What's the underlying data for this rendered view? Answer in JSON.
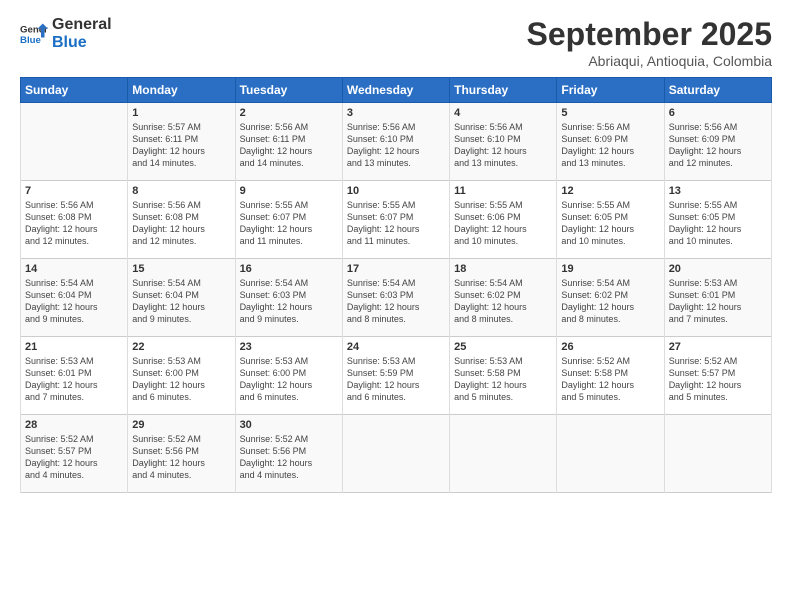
{
  "logo": {
    "line1": "General",
    "line2": "Blue"
  },
  "title": "September 2025",
  "subtitle": "Abriaqui, Antioquia, Colombia",
  "weekdays": [
    "Sunday",
    "Monday",
    "Tuesday",
    "Wednesday",
    "Thursday",
    "Friday",
    "Saturday"
  ],
  "weeks": [
    [
      {
        "day": "",
        "text": ""
      },
      {
        "day": "1",
        "text": "Sunrise: 5:57 AM\nSunset: 6:11 PM\nDaylight: 12 hours\nand 14 minutes."
      },
      {
        "day": "2",
        "text": "Sunrise: 5:56 AM\nSunset: 6:11 PM\nDaylight: 12 hours\nand 14 minutes."
      },
      {
        "day": "3",
        "text": "Sunrise: 5:56 AM\nSunset: 6:10 PM\nDaylight: 12 hours\nand 13 minutes."
      },
      {
        "day": "4",
        "text": "Sunrise: 5:56 AM\nSunset: 6:10 PM\nDaylight: 12 hours\nand 13 minutes."
      },
      {
        "day": "5",
        "text": "Sunrise: 5:56 AM\nSunset: 6:09 PM\nDaylight: 12 hours\nand 13 minutes."
      },
      {
        "day": "6",
        "text": "Sunrise: 5:56 AM\nSunset: 6:09 PM\nDaylight: 12 hours\nand 12 minutes."
      }
    ],
    [
      {
        "day": "7",
        "text": "Sunrise: 5:56 AM\nSunset: 6:08 PM\nDaylight: 12 hours\nand 12 minutes."
      },
      {
        "day": "8",
        "text": "Sunrise: 5:56 AM\nSunset: 6:08 PM\nDaylight: 12 hours\nand 12 minutes."
      },
      {
        "day": "9",
        "text": "Sunrise: 5:55 AM\nSunset: 6:07 PM\nDaylight: 12 hours\nand 11 minutes."
      },
      {
        "day": "10",
        "text": "Sunrise: 5:55 AM\nSunset: 6:07 PM\nDaylight: 12 hours\nand 11 minutes."
      },
      {
        "day": "11",
        "text": "Sunrise: 5:55 AM\nSunset: 6:06 PM\nDaylight: 12 hours\nand 10 minutes."
      },
      {
        "day": "12",
        "text": "Sunrise: 5:55 AM\nSunset: 6:05 PM\nDaylight: 12 hours\nand 10 minutes."
      },
      {
        "day": "13",
        "text": "Sunrise: 5:55 AM\nSunset: 6:05 PM\nDaylight: 12 hours\nand 10 minutes."
      }
    ],
    [
      {
        "day": "14",
        "text": "Sunrise: 5:54 AM\nSunset: 6:04 PM\nDaylight: 12 hours\nand 9 minutes."
      },
      {
        "day": "15",
        "text": "Sunrise: 5:54 AM\nSunset: 6:04 PM\nDaylight: 12 hours\nand 9 minutes."
      },
      {
        "day": "16",
        "text": "Sunrise: 5:54 AM\nSunset: 6:03 PM\nDaylight: 12 hours\nand 9 minutes."
      },
      {
        "day": "17",
        "text": "Sunrise: 5:54 AM\nSunset: 6:03 PM\nDaylight: 12 hours\nand 8 minutes."
      },
      {
        "day": "18",
        "text": "Sunrise: 5:54 AM\nSunset: 6:02 PM\nDaylight: 12 hours\nand 8 minutes."
      },
      {
        "day": "19",
        "text": "Sunrise: 5:54 AM\nSunset: 6:02 PM\nDaylight: 12 hours\nand 8 minutes."
      },
      {
        "day": "20",
        "text": "Sunrise: 5:53 AM\nSunset: 6:01 PM\nDaylight: 12 hours\nand 7 minutes."
      }
    ],
    [
      {
        "day": "21",
        "text": "Sunrise: 5:53 AM\nSunset: 6:01 PM\nDaylight: 12 hours\nand 7 minutes."
      },
      {
        "day": "22",
        "text": "Sunrise: 5:53 AM\nSunset: 6:00 PM\nDaylight: 12 hours\nand 6 minutes."
      },
      {
        "day": "23",
        "text": "Sunrise: 5:53 AM\nSunset: 6:00 PM\nDaylight: 12 hours\nand 6 minutes."
      },
      {
        "day": "24",
        "text": "Sunrise: 5:53 AM\nSunset: 5:59 PM\nDaylight: 12 hours\nand 6 minutes."
      },
      {
        "day": "25",
        "text": "Sunrise: 5:53 AM\nSunset: 5:58 PM\nDaylight: 12 hours\nand 5 minutes."
      },
      {
        "day": "26",
        "text": "Sunrise: 5:52 AM\nSunset: 5:58 PM\nDaylight: 12 hours\nand 5 minutes."
      },
      {
        "day": "27",
        "text": "Sunrise: 5:52 AM\nSunset: 5:57 PM\nDaylight: 12 hours\nand 5 minutes."
      }
    ],
    [
      {
        "day": "28",
        "text": "Sunrise: 5:52 AM\nSunset: 5:57 PM\nDaylight: 12 hours\nand 4 minutes."
      },
      {
        "day": "29",
        "text": "Sunrise: 5:52 AM\nSunset: 5:56 PM\nDaylight: 12 hours\nand 4 minutes."
      },
      {
        "day": "30",
        "text": "Sunrise: 5:52 AM\nSunset: 5:56 PM\nDaylight: 12 hours\nand 4 minutes."
      },
      {
        "day": "",
        "text": ""
      },
      {
        "day": "",
        "text": ""
      },
      {
        "day": "",
        "text": ""
      },
      {
        "day": "",
        "text": ""
      }
    ]
  ]
}
